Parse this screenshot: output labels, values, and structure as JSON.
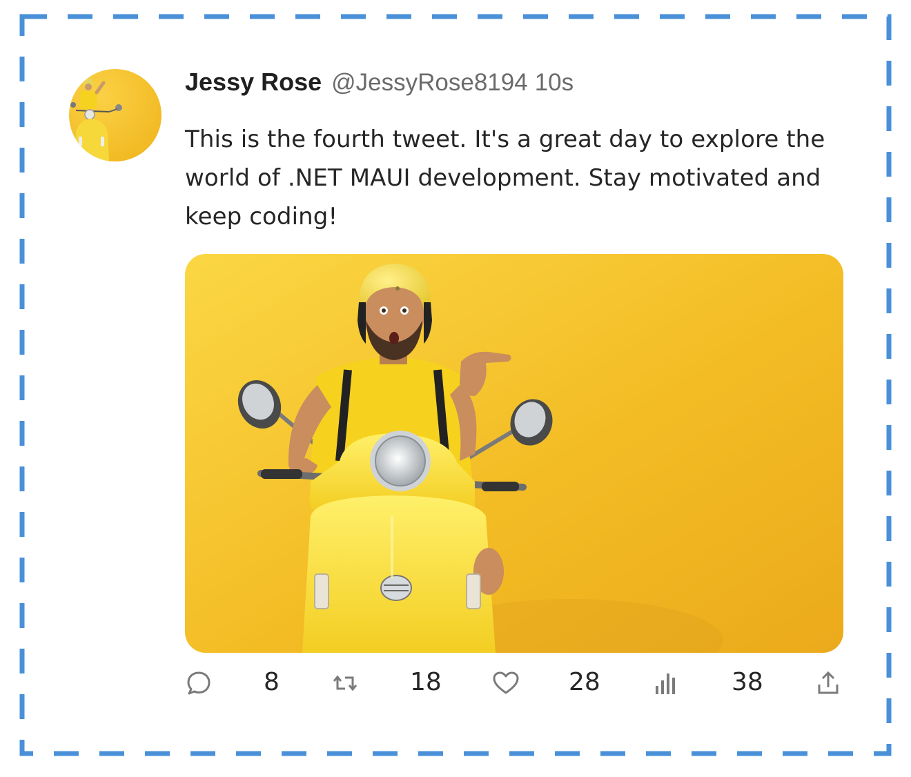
{
  "tweet": {
    "author_name": "Jessy Rose",
    "handle": "@JessyRose8194",
    "timestamp": "10s",
    "text": "This is the fourth tweet. It's a great day to explore the world of .NET MAUI development. Stay motivated and keep coding!",
    "avatar_icon": "avatar-scooter-photo",
    "media_icon": "scooter-rider-photo"
  },
  "actions": {
    "reply_count": "8",
    "retweet_count": "18",
    "like_count": "28",
    "views_count": "38",
    "reply_icon": "comment-icon",
    "retweet_icon": "retweet-icon",
    "like_icon": "heart-icon",
    "views_icon": "analytics-icon",
    "share_icon": "share-icon"
  },
  "colors": {
    "frame_border": "#4A90D9",
    "photo_background": "#F2B91E",
    "muted_text": "#6b6b6b",
    "icon_gray": "#7a7a7a"
  }
}
